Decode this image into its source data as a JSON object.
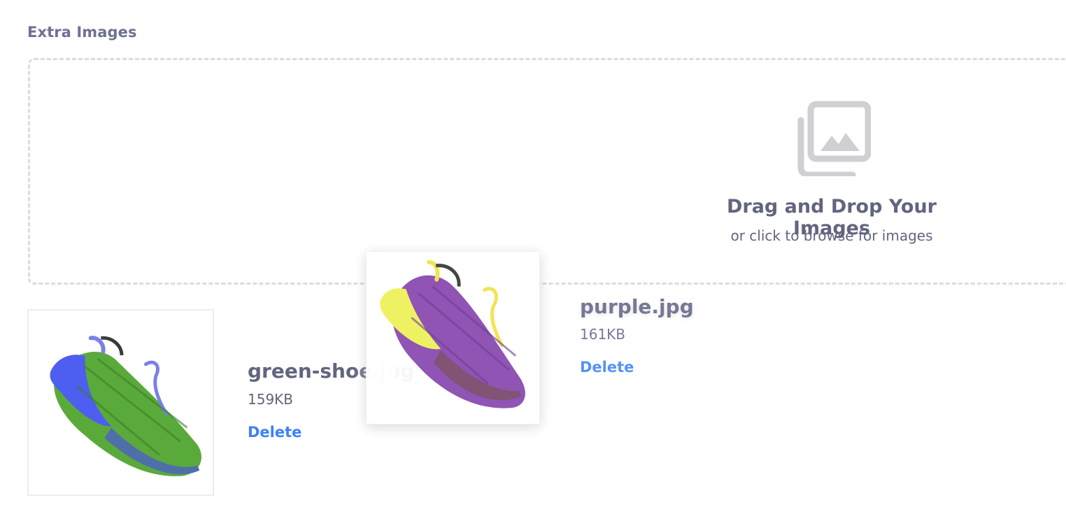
{
  "section": {
    "title": "Extra Images"
  },
  "dropzone": {
    "title": "Drag and Drop Your Images",
    "subtitle": "or click to browse for images",
    "icon": "image-stack-icon"
  },
  "images": [
    {
      "name": "green-shoe.jpg",
      "size": "159KB",
      "delete_label": "Delete",
      "colors": {
        "body": "#5aaa3b",
        "sole": "#4d5ef0",
        "laces": "#7a80e8"
      }
    },
    {
      "name": "purple.jpg",
      "size": "161KB",
      "delete_label": "Delete",
      "colors": {
        "body": "#8a4bb0",
        "sole": "#eef25a",
        "laces": "#f2e34a"
      }
    }
  ],
  "colors": {
    "text": "#62657f",
    "accent": "#3b82f6",
    "border": "#dcdcdf"
  }
}
